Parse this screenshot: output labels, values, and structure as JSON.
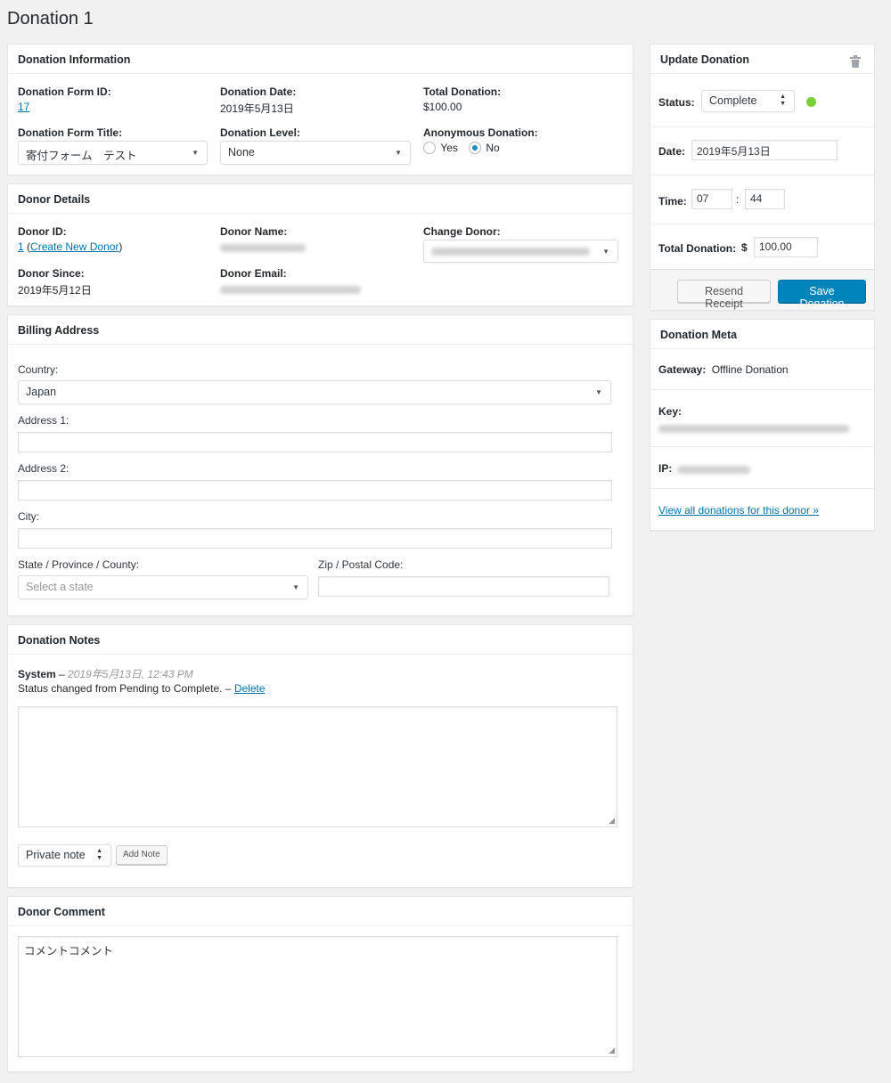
{
  "page_title": "Donation 1",
  "donation_info": {
    "header": "Donation Information",
    "form_id_label": "Donation Form ID:",
    "form_id_value": "17",
    "date_label": "Donation Date:",
    "date_value": "2019年5月13日",
    "total_label": "Total Donation:",
    "total_value": "$100.00",
    "form_title_label": "Donation Form Title:",
    "form_title_value": "寄付フォーム　テスト",
    "level_label": "Donation Level:",
    "level_value": "None",
    "anon_label": "Anonymous Donation:",
    "anon_yes": "Yes",
    "anon_no": "No",
    "anon_selected": "No"
  },
  "donor_details": {
    "header": "Donor Details",
    "donor_id_label": "Donor ID:",
    "donor_id_value": "1",
    "create_new_donor": "Create New Donor",
    "donor_name_label": "Donor Name:",
    "change_donor_label": "Change Donor:",
    "donor_since_label": "Donor Since:",
    "donor_since_value": "2019年5月12日",
    "donor_email_label": "Donor Email:"
  },
  "billing": {
    "header": "Billing Address",
    "country_label": "Country:",
    "country_value": "Japan",
    "address1_label": "Address 1:",
    "address2_label": "Address 2:",
    "city_label": "City:",
    "state_label": "State / Province / County:",
    "state_placeholder": "Select a state",
    "zip_label": "Zip / Postal Code:"
  },
  "notes": {
    "header": "Donation Notes",
    "author": "System",
    "separator": " – ",
    "date": "2019年5月13日, 12:43 PM",
    "text": "Status changed from Pending to Complete. – ",
    "delete_label": "Delete",
    "note_type": "Private note",
    "add_note_label": "Add Note"
  },
  "donor_comment": {
    "header": "Donor Comment",
    "text": "コメントコメント"
  },
  "update": {
    "header": "Update Donation",
    "status_label": "Status:",
    "status_value": "Complete",
    "status_color": "#7ad03a",
    "date_label": "Date:",
    "date_value": "2019年5月13日",
    "time_label": "Time:",
    "hour": "07",
    "minute": "44",
    "time_sep": ":",
    "total_label": "Total Donation:",
    "currency": "$",
    "total_value": "100.00",
    "resend_label": "Resend Receipt",
    "save_label": "Save Donation"
  },
  "meta": {
    "header": "Donation Meta",
    "gateway_label": "Gateway:",
    "gateway_value": "Offline Donation",
    "key_label": "Key:",
    "ip_label": "IP:",
    "view_all_label": "View all donations for this donor »"
  },
  "colors": {
    "accent": "#0073aa",
    "primary_button": "#0085ba"
  }
}
